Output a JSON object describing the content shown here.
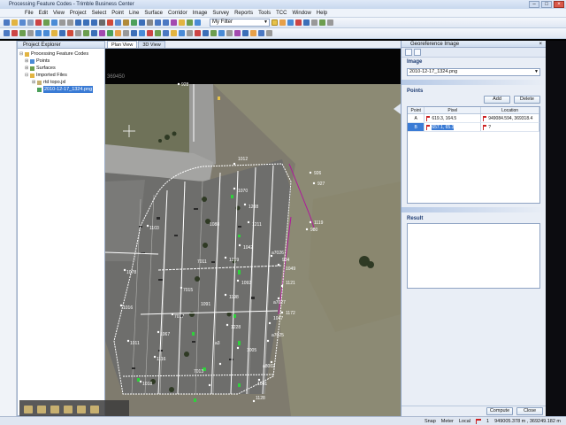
{
  "window": {
    "title": "Processing Feature Codes - Trimble Business Center"
  },
  "menu": [
    "File",
    "Edit",
    "View",
    "Project",
    "Select",
    "Point",
    "Line",
    "Surface",
    "Corridor",
    "Image",
    "Survey",
    "Reports",
    "Tools",
    "TCC",
    "Window",
    "Help"
  ],
  "toolbar": {
    "filter_value": "My Filter"
  },
  "project_explorer": {
    "title": "Project Explorer",
    "root": "Processing Feature Codes",
    "items": [
      "Points",
      "Surfaces",
      "Imported Files",
      "rtd topo.jxl",
      "2010-12-17_1324.png"
    ],
    "selected": "2010-12-17_1324.png"
  },
  "tabs": [
    "Plan View",
    "3D View"
  ],
  "active_tab": "Plan View",
  "map": {
    "top_value": "369450",
    "point_labels": [
      "928",
      "926",
      "927",
      "1119",
      "980",
      "934",
      "a7026",
      "1049",
      "1121",
      "a7027",
      "1172",
      "1047",
      "a7025",
      "1005",
      "a8002",
      "1041",
      "1128",
      "1012",
      "1070",
      "1208",
      "1211",
      "1042",
      "1219",
      "1092",
      "1198",
      "1228",
      "7015",
      "7017",
      "1067",
      "1116",
      "1018",
      "1011",
      "1016",
      "1078",
      "1103",
      "1088",
      "7011",
      "1091",
      "a3",
      "7013"
    ]
  },
  "georef": {
    "title": "Georeference Image",
    "image_section": "Image",
    "image_value": "2010-12-17_1324.png",
    "points_section": "Points",
    "add_label": "Add",
    "delete_label": "Delete",
    "columns": [
      "Point",
      "Pixel",
      "Location"
    ],
    "rows": [
      {
        "point": "A",
        "pixel": "619.3, 164.5",
        "location": "949084.594, 369318.4"
      },
      {
        "point": "B",
        "pixel": "657.1, 65.3",
        "location": "?"
      }
    ],
    "result_section": "Result",
    "compute_label": "Compute",
    "close_label": "Close"
  },
  "status": {
    "snap": "Snap",
    "units": "Meter",
    "local": "Local",
    "count": "1",
    "coords": "949005.378 m , 369249.182 m"
  },
  "colors": {
    "accent": "#3a7bd5",
    "boundary": "#ffffff",
    "highlight": "#2fd13c",
    "line_magenta": "#b0169c"
  }
}
